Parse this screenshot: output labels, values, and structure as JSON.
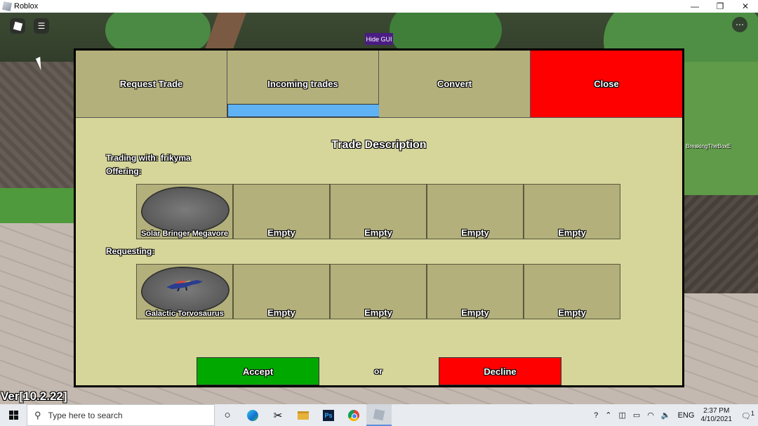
{
  "window": {
    "title": "Roblox",
    "minimize": "—",
    "restore": "❐",
    "close": "✕"
  },
  "hud": {
    "hide_gui": "Hide GUI",
    "player_tag": "BreakingTheBoxE",
    "version": "Ver[10.2.22]"
  },
  "tabs": [
    {
      "label": "Request Trade"
    },
    {
      "label": "Incoming trades"
    },
    {
      "label": "Convert"
    },
    {
      "label": "Close"
    }
  ],
  "trade": {
    "heading": "Trade Description",
    "trading_with": "Trading with: frikyma",
    "offering_label": "Offering:",
    "requesting_label": "Requesting:",
    "offering": [
      "Solar Bringer Megavore",
      "Empty",
      "Empty",
      "Empty",
      "Empty"
    ],
    "requesting": [
      "Galactic Torvosaurus",
      "Empty",
      "Empty",
      "Empty",
      "Empty"
    ],
    "accept": "Accept",
    "or": "or",
    "decline": "Decline"
  },
  "taskbar": {
    "search_placeholder": "Type here to search",
    "language": "ENG",
    "time": "2:37 PM",
    "date": "4/10/2021",
    "notification_count": "1"
  },
  "colors": {
    "accept": "#00a800",
    "decline": "#ff0000",
    "close_tab": "#ff0000",
    "tab_indicator": "#5fb2f4",
    "panel": "#d6d69b",
    "slot": "#b3b07c"
  }
}
